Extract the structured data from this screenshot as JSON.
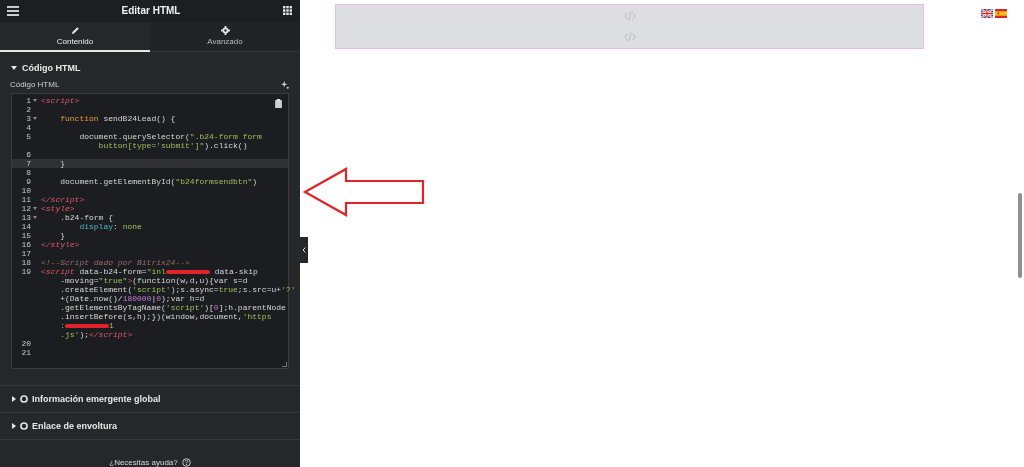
{
  "panel": {
    "title": "Editar HTML",
    "tabs": [
      {
        "label": "Contenido",
        "selected": true
      },
      {
        "label": "Avanzado",
        "selected": false
      }
    ],
    "section": {
      "title": "Código HTML",
      "expanded": true
    },
    "field_label": "Código HTML",
    "code_lines": [
      {
        "number": "1",
        "foldable": true,
        "active": false,
        "rows": [
          {
            "segments": [
              {
                "kind": "tag",
                "text": "<script>"
              }
            ]
          }
        ]
      },
      {
        "number": "2",
        "foldable": false,
        "active": false,
        "rows": [
          {
            "segments": []
          }
        ]
      },
      {
        "number": "3",
        "foldable": true,
        "active": false,
        "rows": [
          {
            "segments": [
              {
                "kind": "keyword",
                "text": "    function"
              },
              {
                "kind": "plain",
                "text": " sendB24Lead() {"
              }
            ]
          }
        ]
      },
      {
        "number": "4",
        "foldable": false,
        "active": false,
        "rows": [
          {
            "segments": []
          }
        ]
      },
      {
        "number": "5",
        "foldable": false,
        "active": false,
        "rows": [
          {
            "segments": [
              {
                "kind": "plain",
                "text": "        document.querySelector("
              },
              {
                "kind": "string",
                "text": "\".b24-form form"
              }
            ]
          },
          {
            "segments": [
              {
                "kind": "string",
                "text": "            button[type='submit']\""
              },
              {
                "kind": "plain",
                "text": ").click()"
              }
            ]
          }
        ]
      },
      {
        "number": "6",
        "foldable": false,
        "active": false,
        "rows": [
          {
            "segments": []
          }
        ]
      },
      {
        "number": "7",
        "foldable": false,
        "active": true,
        "rows": [
          {
            "segments": [
              {
                "kind": "plain",
                "text": "    }"
              }
            ]
          }
        ]
      },
      {
        "number": "8",
        "foldable": false,
        "active": false,
        "rows": [
          {
            "segments": []
          }
        ]
      },
      {
        "number": "9",
        "foldable": false,
        "active": false,
        "rows": [
          {
            "segments": [
              {
                "kind": "plain",
                "text": "    document.getElementById("
              },
              {
                "kind": "string",
                "text": "\"b24formsendbtn\""
              },
              {
                "kind": "plain",
                "text": ")"
              }
            ]
          }
        ]
      },
      {
        "number": "10",
        "foldable": false,
        "active": false,
        "rows": [
          {
            "segments": []
          }
        ]
      },
      {
        "number": "11",
        "foldable": false,
        "active": false,
        "rows": [
          {
            "segments": [
              {
                "kind": "tag",
                "text": "</script>"
              }
            ]
          }
        ]
      },
      {
        "number": "12",
        "foldable": true,
        "active": false,
        "rows": [
          {
            "segments": [
              {
                "kind": "tag",
                "text": "<style>"
              }
            ]
          }
        ]
      },
      {
        "number": "13",
        "foldable": true,
        "active": false,
        "rows": [
          {
            "segments": [
              {
                "kind": "plain",
                "text": "    .b24-form {"
              }
            ]
          }
        ]
      },
      {
        "number": "14",
        "foldable": false,
        "active": false,
        "rows": [
          {
            "segments": [
              {
                "kind": "property",
                "text": "        display"
              },
              {
                "kind": "plain",
                "text": ": "
              },
              {
                "kind": "value",
                "text": "none"
              }
            ]
          }
        ]
      },
      {
        "number": "15",
        "foldable": false,
        "active": false,
        "rows": [
          {
            "segments": [
              {
                "kind": "plain",
                "text": "    }"
              }
            ]
          }
        ]
      },
      {
        "number": "16",
        "foldable": false,
        "active": false,
        "rows": [
          {
            "segments": [
              {
                "kind": "tag",
                "text": "</style>"
              }
            ]
          }
        ]
      },
      {
        "number": "17",
        "foldable": false,
        "active": false,
        "rows": [
          {
            "segments": []
          }
        ]
      },
      {
        "number": "18",
        "foldable": false,
        "active": false,
        "rows": [
          {
            "segments": [
              {
                "kind": "comment",
                "text": "<!--Script dado por Bitrix24-->"
              }
            ]
          }
        ]
      },
      {
        "number": "19",
        "foldable": false,
        "active": false,
        "rows": [
          {
            "segments": [
              {
                "kind": "tag",
                "text": "<script"
              },
              {
                "kind": "plain",
                "text": " data-b24-form="
              },
              {
                "kind": "string",
                "text": "\"inl"
              },
              {
                "kind": "redaction"
              },
              {
                "kind": "plain",
                "text": " data-skip"
              }
            ]
          },
          {
            "segments": [
              {
                "kind": "plain",
                "text": "    -moving="
              },
              {
                "kind": "string",
                "text": "\"true\""
              },
              {
                "kind": "tag",
                "text": ">"
              },
              {
                "kind": "plain",
                "text": "(function(w,d,u){var s=d"
              }
            ]
          },
          {
            "segments": [
              {
                "kind": "plain",
                "text": "    .createElement("
              },
              {
                "kind": "string",
                "text": "'script'"
              },
              {
                "kind": "plain",
                "text": ");s.async="
              },
              {
                "kind": "value",
                "text": "true"
              },
              {
                "kind": "plain",
                "text": ";s.src=u+"
              },
              {
                "kind": "string",
                "text": "'?'"
              }
            ]
          },
          {
            "segments": [
              {
                "kind": "plain",
                "text": "    +(Date.now()/"
              },
              {
                "kind": "number",
                "text": "180000"
              },
              {
                "kind": "plain",
                "text": "|"
              },
              {
                "kind": "number",
                "text": "0"
              },
              {
                "kind": "plain",
                "text": ");var h=d"
              }
            ]
          },
          {
            "segments": [
              {
                "kind": "plain",
                "text": "    .getElementsByTagName("
              },
              {
                "kind": "string",
                "text": "'script'"
              },
              {
                "kind": "plain",
                "text": ")["
              },
              {
                "kind": "number",
                "text": "0"
              },
              {
                "kind": "plain",
                "text": "];h.parentNode"
              }
            ]
          },
          {
            "segments": [
              {
                "kind": "plain",
                "text": "    .insertBefore(s,h);})(window,document,"
              },
              {
                "kind": "string",
                "text": "'https"
              }
            ]
          },
          {
            "segments": [
              {
                "kind": "string",
                "text": "    :"
              },
              {
                "kind": "redaction"
              },
              {
                "kind": "string",
                "text": "1"
              }
            ]
          },
          {
            "segments": [
              {
                "kind": "string",
                "text": "    .js'"
              },
              {
                "kind": "plain",
                "text": ");"
              },
              {
                "kind": "tag",
                "text": "</script>"
              }
            ]
          }
        ]
      },
      {
        "number": "20",
        "foldable": false,
        "active": false,
        "rows": [
          {
            "segments": []
          }
        ]
      },
      {
        "number": "21",
        "foldable": false,
        "active": false,
        "rows": [
          {
            "segments": []
          }
        ]
      }
    ],
    "collapsed_sections": [
      {
        "title": "Información emergente global",
        "expanded": false
      },
      {
        "title": "Enlace de envoltura",
        "expanded": false
      }
    ],
    "help_link": "¿Necesitas ayuda?"
  },
  "canvas": {
    "placeholders": [
      {
        "kind": "html-widget"
      },
      {
        "kind": "html-widget"
      }
    ]
  }
}
